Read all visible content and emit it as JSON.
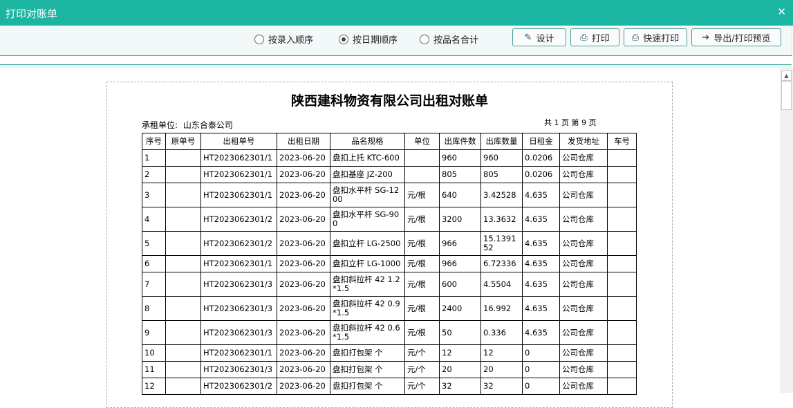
{
  "window": {
    "title": "打印对账单"
  },
  "toolbar": {
    "radios": [
      {
        "label": "按录入顺序",
        "checked": false
      },
      {
        "label": "按日期顺序",
        "checked": true
      },
      {
        "label": "按品名合计",
        "checked": false
      }
    ],
    "buttons": [
      {
        "label": "设计",
        "icon": "design-edit-icon"
      },
      {
        "label": "打印",
        "icon": "printer-icon"
      },
      {
        "label": "快速打印",
        "icon": "quick-print-icon"
      },
      {
        "label": "导出/打印预览",
        "icon": "export-arrow-icon"
      }
    ]
  },
  "report": {
    "title": "陕西建科物资有限公司出租对账单",
    "lessee_label": "承租单位:",
    "lessee_value": "山东合泰公司",
    "page_info": "共 1 页 第 9 页"
  },
  "table": {
    "columns": [
      "序号",
      "原单号",
      "出租单号",
      "出租日期",
      "品名规格",
      "单位",
      "出库件数",
      "出库数量",
      "日租金",
      "发货地址",
      "车号"
    ],
    "rows": [
      [
        "1",
        "",
        "HT2023062301/1",
        "2023-06-20",
        "盘扣上托 KTC-600",
        "",
        "960",
        "960",
        "0.0206",
        "公司仓库",
        ""
      ],
      [
        "2",
        "",
        "HT2023062301/1",
        "2023-06-20",
        "盘扣基座 JZ-200",
        "",
        "805",
        "805",
        "0.0206",
        "公司仓库",
        ""
      ],
      [
        "3",
        "",
        "HT2023062301/1",
        "2023-06-20",
        "盘扣水平杆 SG-1200",
        "元/根",
        "640",
        "3.42528",
        "4.635",
        "公司仓库",
        ""
      ],
      [
        "4",
        "",
        "HT2023062301/2",
        "2023-06-20",
        "盘扣水平杆 SG-900",
        "元/根",
        "3200",
        "13.3632",
        "4.635",
        "公司仓库",
        ""
      ],
      [
        "5",
        "",
        "HT2023062301/2",
        "2023-06-20",
        "盘扣立杆 LG-2500",
        "元/根",
        "966",
        "15.139152",
        "4.635",
        "公司仓库",
        ""
      ],
      [
        "6",
        "",
        "HT2023062301/1",
        "2023-06-20",
        "盘扣立杆 LG-1000",
        "元/根",
        "966",
        "6.72336",
        "4.635",
        "公司仓库",
        ""
      ],
      [
        "7",
        "",
        "HT2023062301/3",
        "2023-06-20",
        "盘扣斜拉杆 42 1.2*1.5",
        "元/根",
        "600",
        "4.5504",
        "4.635",
        "公司仓库",
        ""
      ],
      [
        "8",
        "",
        "HT2023062301/3",
        "2023-06-20",
        "盘扣斜拉杆 42 0.9*1.5",
        "元/根",
        "2400",
        "16.992",
        "4.635",
        "公司仓库",
        ""
      ],
      [
        "9",
        "",
        "HT2023062301/3",
        "2023-06-20",
        "盘扣斜拉杆 42 0.6*1.5",
        "元/根",
        "50",
        "0.336",
        "4.635",
        "公司仓库",
        ""
      ],
      [
        "10",
        "",
        "HT2023062301/1",
        "2023-06-20",
        "盘扣打包架 个",
        "元/个",
        "12",
        "12",
        "0",
        "公司仓库",
        ""
      ],
      [
        "11",
        "",
        "HT2023062301/3",
        "2023-06-20",
        "盘扣打包架 个",
        "元/个",
        "20",
        "20",
        "0",
        "公司仓库",
        ""
      ],
      [
        "12",
        "",
        "HT2023062301/2",
        "2023-06-20",
        "盘扣打包架 个",
        "元/个",
        "32",
        "32",
        "0",
        "公司仓库",
        ""
      ]
    ]
  }
}
